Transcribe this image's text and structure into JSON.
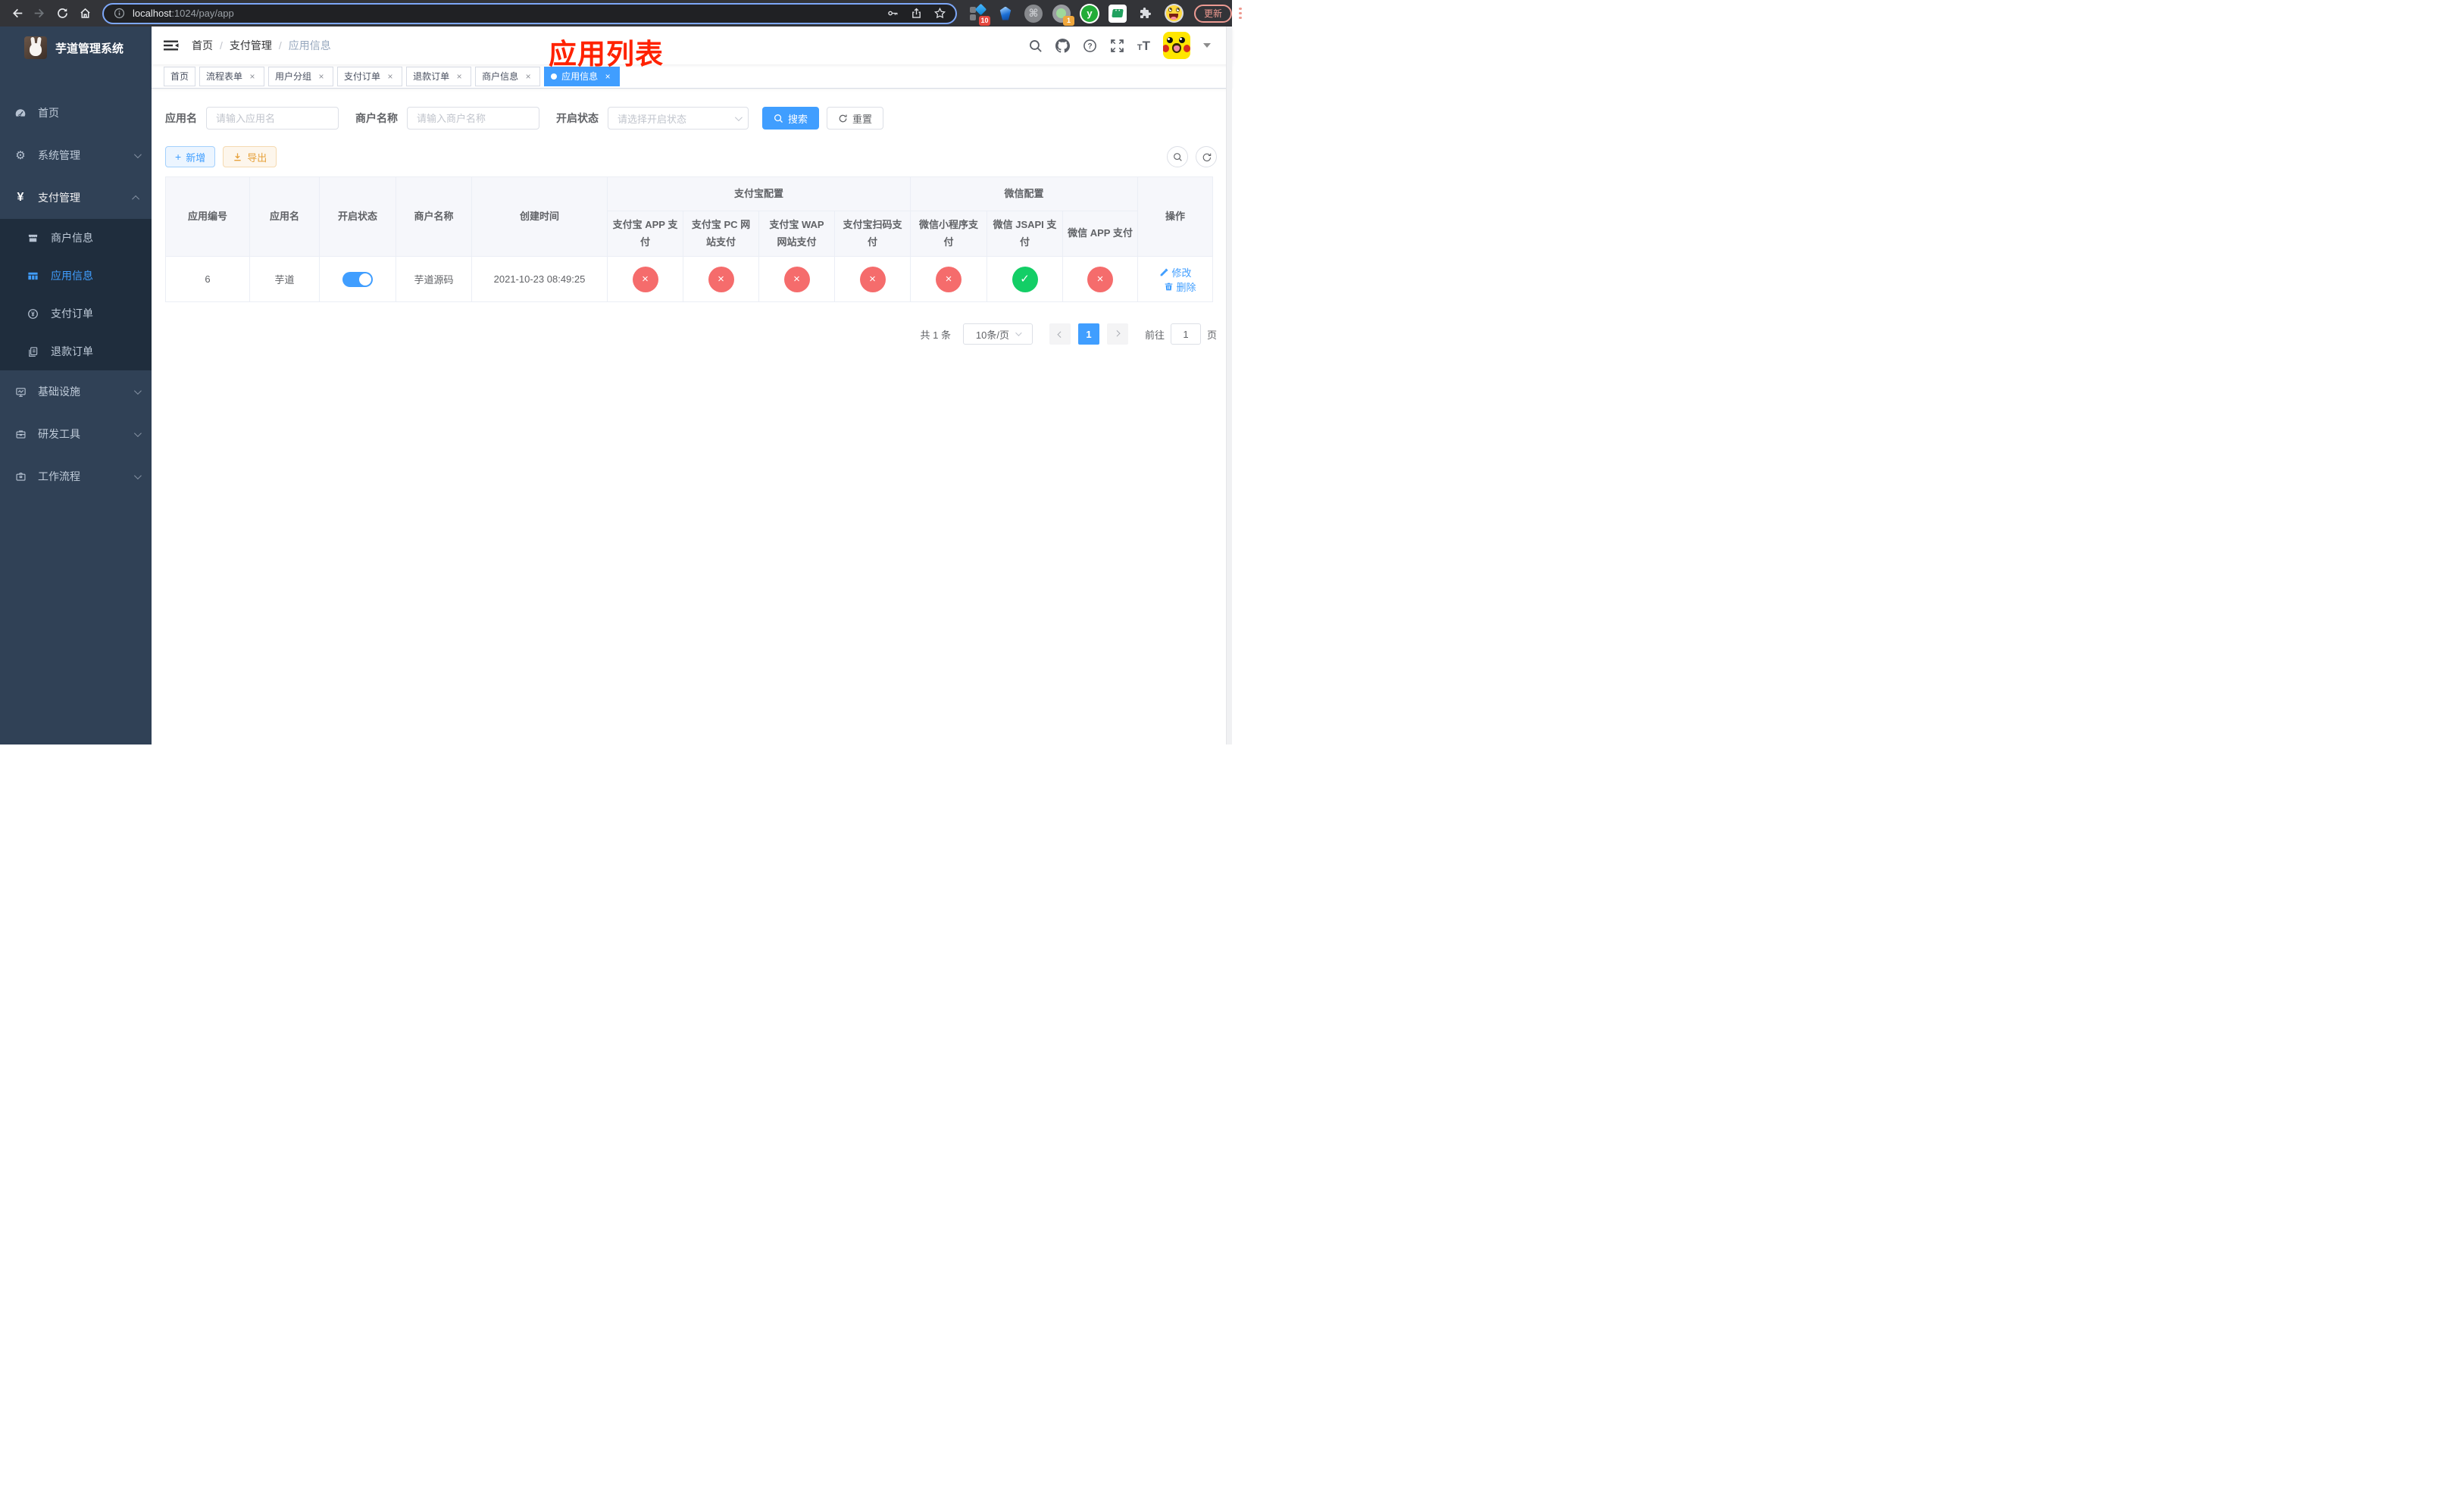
{
  "theme": {
    "primary": "#409eff",
    "success": "#13ce66",
    "danger": "#f56c6c",
    "warning": "#e6a23c",
    "sidebar-bg": "#304156",
    "submenu-bg": "#1f2d3d",
    "annotation": "#ff2200"
  },
  "browser": {
    "url_host": "localhost",
    "url_rest": ":1024/pay/app",
    "ext_badge_translate": "10",
    "ext_badge_camera": "1",
    "ext_y_letter": "y",
    "update_label": "更新"
  },
  "annotation": "应用列表",
  "sidebar": {
    "logo_title": "芋道管理系统",
    "items": [
      {
        "label": "首页",
        "icon": "dashboard-icon"
      },
      {
        "label": "系统管理",
        "icon": "gear-icon",
        "chevron": "down"
      },
      {
        "label": "支付管理",
        "icon": "yen-icon",
        "chevron": "up",
        "active": true
      },
      {
        "label": "基础设施",
        "icon": "monitor-icon",
        "chevron": "down"
      },
      {
        "label": "研发工具",
        "icon": "toolbox-icon",
        "chevron": "down"
      },
      {
        "label": "工作流程",
        "icon": "briefcase-icon",
        "chevron": "down"
      }
    ],
    "pay_submenu": [
      {
        "label": "商户信息",
        "icon": "store-icon"
      },
      {
        "label": "应用信息",
        "icon": "grid-icon",
        "active": true
      },
      {
        "label": "支付订单",
        "icon": "yen-circle-icon"
      },
      {
        "label": "退款订单",
        "icon": "documents-icon"
      }
    ]
  },
  "navbar": {
    "breadcrumb": [
      "首页",
      "支付管理",
      "应用信息"
    ]
  },
  "tags": [
    {
      "label": "首页",
      "closable": false
    },
    {
      "label": "流程表单",
      "closable": true
    },
    {
      "label": "用户分组",
      "closable": true
    },
    {
      "label": "支付订单",
      "closable": true
    },
    {
      "label": "退款订单",
      "closable": true
    },
    {
      "label": "商户信息",
      "closable": true
    },
    {
      "label": "应用信息",
      "closable": true,
      "active": true
    }
  ],
  "filters": {
    "app_name_label": "应用名",
    "app_name_placeholder": "请输入应用名",
    "merchant_label": "商户名称",
    "merchant_placeholder": "请输入商户名称",
    "status_label": "开启状态",
    "status_placeholder": "请选择开启状态",
    "search_label": "搜索",
    "reset_label": "重置"
  },
  "toolbar": {
    "add_label": "新增",
    "export_label": "导出"
  },
  "table": {
    "headers": {
      "id": "应用编号",
      "name": "应用名",
      "status": "开启状态",
      "merchant": "商户名称",
      "created": "创建时间",
      "group_alipay": "支付宝配置",
      "group_wechat": "微信配置",
      "alipay_app": "支付宝 APP 支付",
      "alipay_pc": "支付宝 PC 网站支付",
      "alipay_wap": "支付宝 WAP 网站支付",
      "alipay_qr": "支付宝扫码支付",
      "wx_lite": "微信小程序支付",
      "wx_jsapi": "微信 JSAPI 支付",
      "wx_app": "微信 APP 支付",
      "ops": "操作"
    },
    "rows": [
      {
        "id": "6",
        "name": "芋道",
        "enabled": true,
        "merchant": "芋道源码",
        "created": "2021-10-23 08:49:25",
        "alipay_app": false,
        "alipay_pc": false,
        "alipay_wap": false,
        "alipay_qr": false,
        "wx_lite": false,
        "wx_jsapi": true,
        "wx_app": false
      }
    ],
    "edit_label": "修改",
    "delete_label": "删除"
  },
  "pagination": {
    "total": "共 1 条",
    "page_size": "10条/页",
    "current_page": "1",
    "goto_label": "前往",
    "goto_value": "1",
    "page_label": "页"
  }
}
